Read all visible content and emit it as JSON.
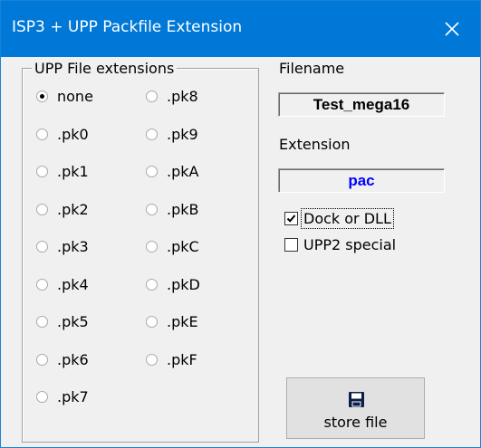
{
  "window": {
    "title": "ISP3 + UPP Packfile Extension",
    "close_glyph": "✕",
    "colors": {
      "titlebar": "#0078d7",
      "face": "#f0f0f0",
      "accent_text": "#0000ff"
    }
  },
  "group": {
    "legend": "UPP File extensions",
    "selected": "none",
    "options": [
      "none",
      ".pk0",
      ".pk1",
      ".pk2",
      ".pk3",
      ".pk4",
      ".pk5",
      ".pk6",
      ".pk7",
      ".pk8",
      ".pk9",
      ".pkA",
      ".pkB",
      ".pkC",
      ".pkD",
      ".pkE",
      ".pkF"
    ]
  },
  "filename": {
    "label": "Filename",
    "value": "Test_mega16"
  },
  "extension": {
    "label": "Extension",
    "value": "pac"
  },
  "checks": {
    "dock": {
      "label": "Dock or DLL",
      "checked": true
    },
    "upp2": {
      "label": "UPP2 special",
      "checked": false
    }
  },
  "store": {
    "label": "store file",
    "icon": "floppy-disk-icon"
  }
}
